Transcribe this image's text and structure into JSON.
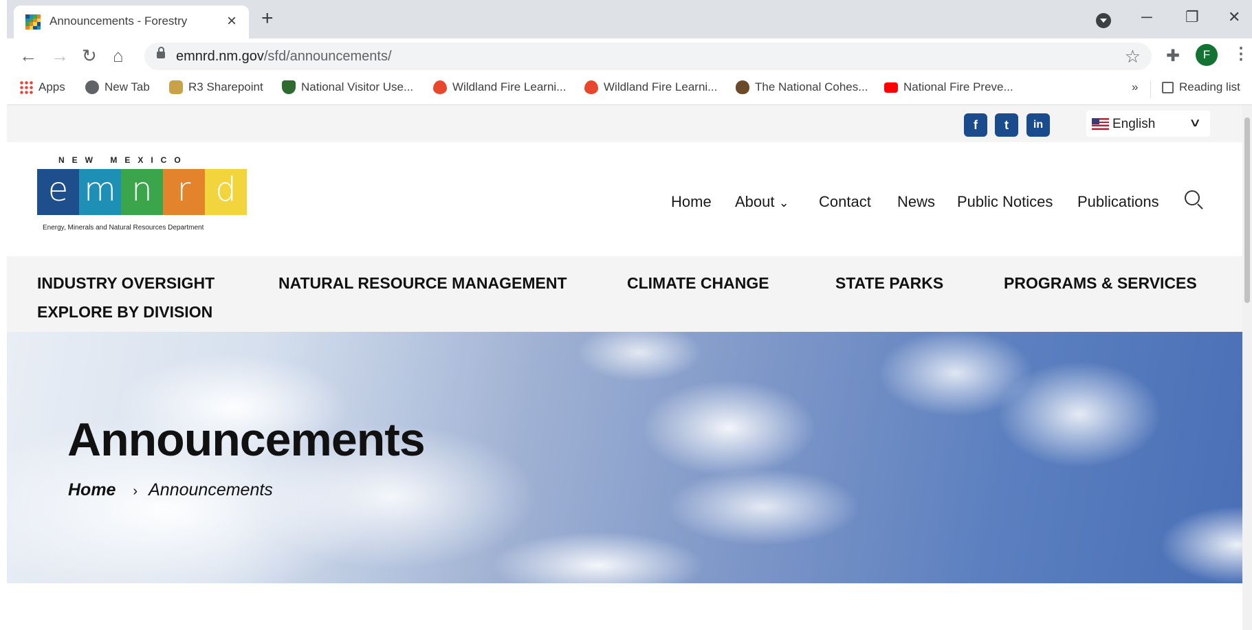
{
  "browser": {
    "tab_title": "Announcements - Forestry",
    "tab_close": "×",
    "new_tab": "+",
    "url_host": "emnrd.nm.gov",
    "url_path": "/sfd/announcements/",
    "profile_initial": "F",
    "bookmarks": [
      {
        "label": "Apps",
        "icon": "apps-grid-icon"
      },
      {
        "label": "New Tab",
        "icon": "globe-icon"
      },
      {
        "label": "R3 Sharepoint",
        "icon": "usfs-badge-icon"
      },
      {
        "label": "National Visitor Use...",
        "icon": "usfs-shield-icon"
      },
      {
        "label": "Wildland Fire Learni...",
        "icon": "flame-icon"
      },
      {
        "label": "Wildland Fire Learni...",
        "icon": "flame-icon"
      },
      {
        "label": "The National Cohes...",
        "icon": "pinecone-icon"
      },
      {
        "label": "National Fire Preve...",
        "icon": "youtube-icon"
      }
    ],
    "bookmarks_overflow": "»",
    "reading_list": "Reading list"
  },
  "site": {
    "social": [
      {
        "name": "facebook",
        "glyph": "f"
      },
      {
        "name": "twitter",
        "glyph": "t"
      },
      {
        "name": "linkedin",
        "glyph": "in"
      }
    ],
    "language": "English",
    "logo": {
      "top_text": "NEW MEXICO",
      "letters": [
        "e",
        "m",
        "n",
        "r",
        "d"
      ],
      "colors": [
        "#1f4e8c",
        "#1e8fb5",
        "#3aa54a",
        "#e3832b",
        "#f2d43c"
      ],
      "subtitle": "Energy, Minerals and Natural Resources Department"
    },
    "main_nav": {
      "home": "Home",
      "about": "About",
      "about_chevron": "⌄",
      "contact": "Contact",
      "news": "News",
      "public_notices": "Public Notices",
      "publications": "Publications"
    },
    "categories": {
      "industry": "INDUSTRY OVERSIGHT",
      "natural": "NATURAL RESOURCE MANAGEMENT",
      "climate": "CLIMATE CHANGE",
      "parks": "STATE PARKS",
      "programs": "PROGRAMS & SERVICES",
      "division": "EXPLORE BY DIVISION"
    },
    "hero": {
      "title": "Announcements",
      "breadcrumb_home": "Home",
      "breadcrumb_sep": "›",
      "breadcrumb_current": "Announcements"
    }
  }
}
